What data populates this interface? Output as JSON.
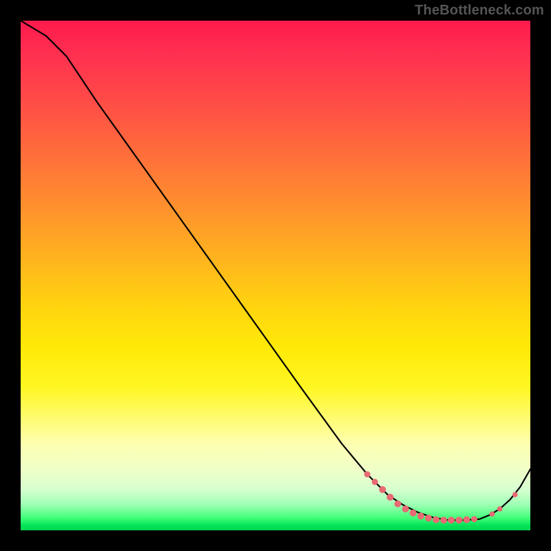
{
  "watermark": "TheBottleneck.com",
  "chart_data": {
    "type": "line",
    "title": "",
    "xlabel": "",
    "ylabel": "",
    "xlim": [
      0,
      100
    ],
    "ylim": [
      0,
      100
    ],
    "grid": false,
    "legend": false,
    "series": [
      {
        "name": "curve",
        "x": [
          0,
          5,
          9,
          15,
          25,
          35,
          45,
          55,
          63,
          68,
          72,
          75,
          78,
          81,
          84,
          87,
          90,
          92,
          94,
          96,
          98,
          100
        ],
        "y": [
          100,
          97,
          93,
          84,
          70,
          56,
          42,
          28,
          17,
          11,
          7,
          5,
          3.5,
          2.5,
          2,
          2,
          2.2,
          3,
          4.2,
          6,
          8.5,
          12
        ]
      }
    ],
    "markers": [
      {
        "x": 68,
        "y": 11,
        "r": 4.5
      },
      {
        "x": 69.5,
        "y": 9.5,
        "r": 4.5
      },
      {
        "x": 71,
        "y": 8,
        "r": 5.0
      },
      {
        "x": 72.5,
        "y": 6.5,
        "r": 5.0
      },
      {
        "x": 74,
        "y": 5.2,
        "r": 5.0
      },
      {
        "x": 75.5,
        "y": 4.2,
        "r": 5.0
      },
      {
        "x": 77,
        "y": 3.4,
        "r": 5.0
      },
      {
        "x": 78.5,
        "y": 2.8,
        "r": 5.0
      },
      {
        "x": 80,
        "y": 2.4,
        "r": 5.0
      },
      {
        "x": 81.5,
        "y": 2.1,
        "r": 5.0
      },
      {
        "x": 83,
        "y": 2.0,
        "r": 5.0
      },
      {
        "x": 84.5,
        "y": 2.0,
        "r": 5.0
      },
      {
        "x": 86,
        "y": 2.0,
        "r": 5.0
      },
      {
        "x": 87.5,
        "y": 2.1,
        "r": 5.0
      },
      {
        "x": 89,
        "y": 2.2,
        "r": 4.5
      },
      {
        "x": 92.5,
        "y": 3.2,
        "r": 3.8
      },
      {
        "x": 94,
        "y": 4.2,
        "r": 3.8
      },
      {
        "x": 97,
        "y": 7.0,
        "r": 3.8
      }
    ],
    "background_gradient_direction": "vertical",
    "background_gradient_note": "red at top through orange, yellow, pale-yellow, pale-green to bright green at bottom"
  }
}
